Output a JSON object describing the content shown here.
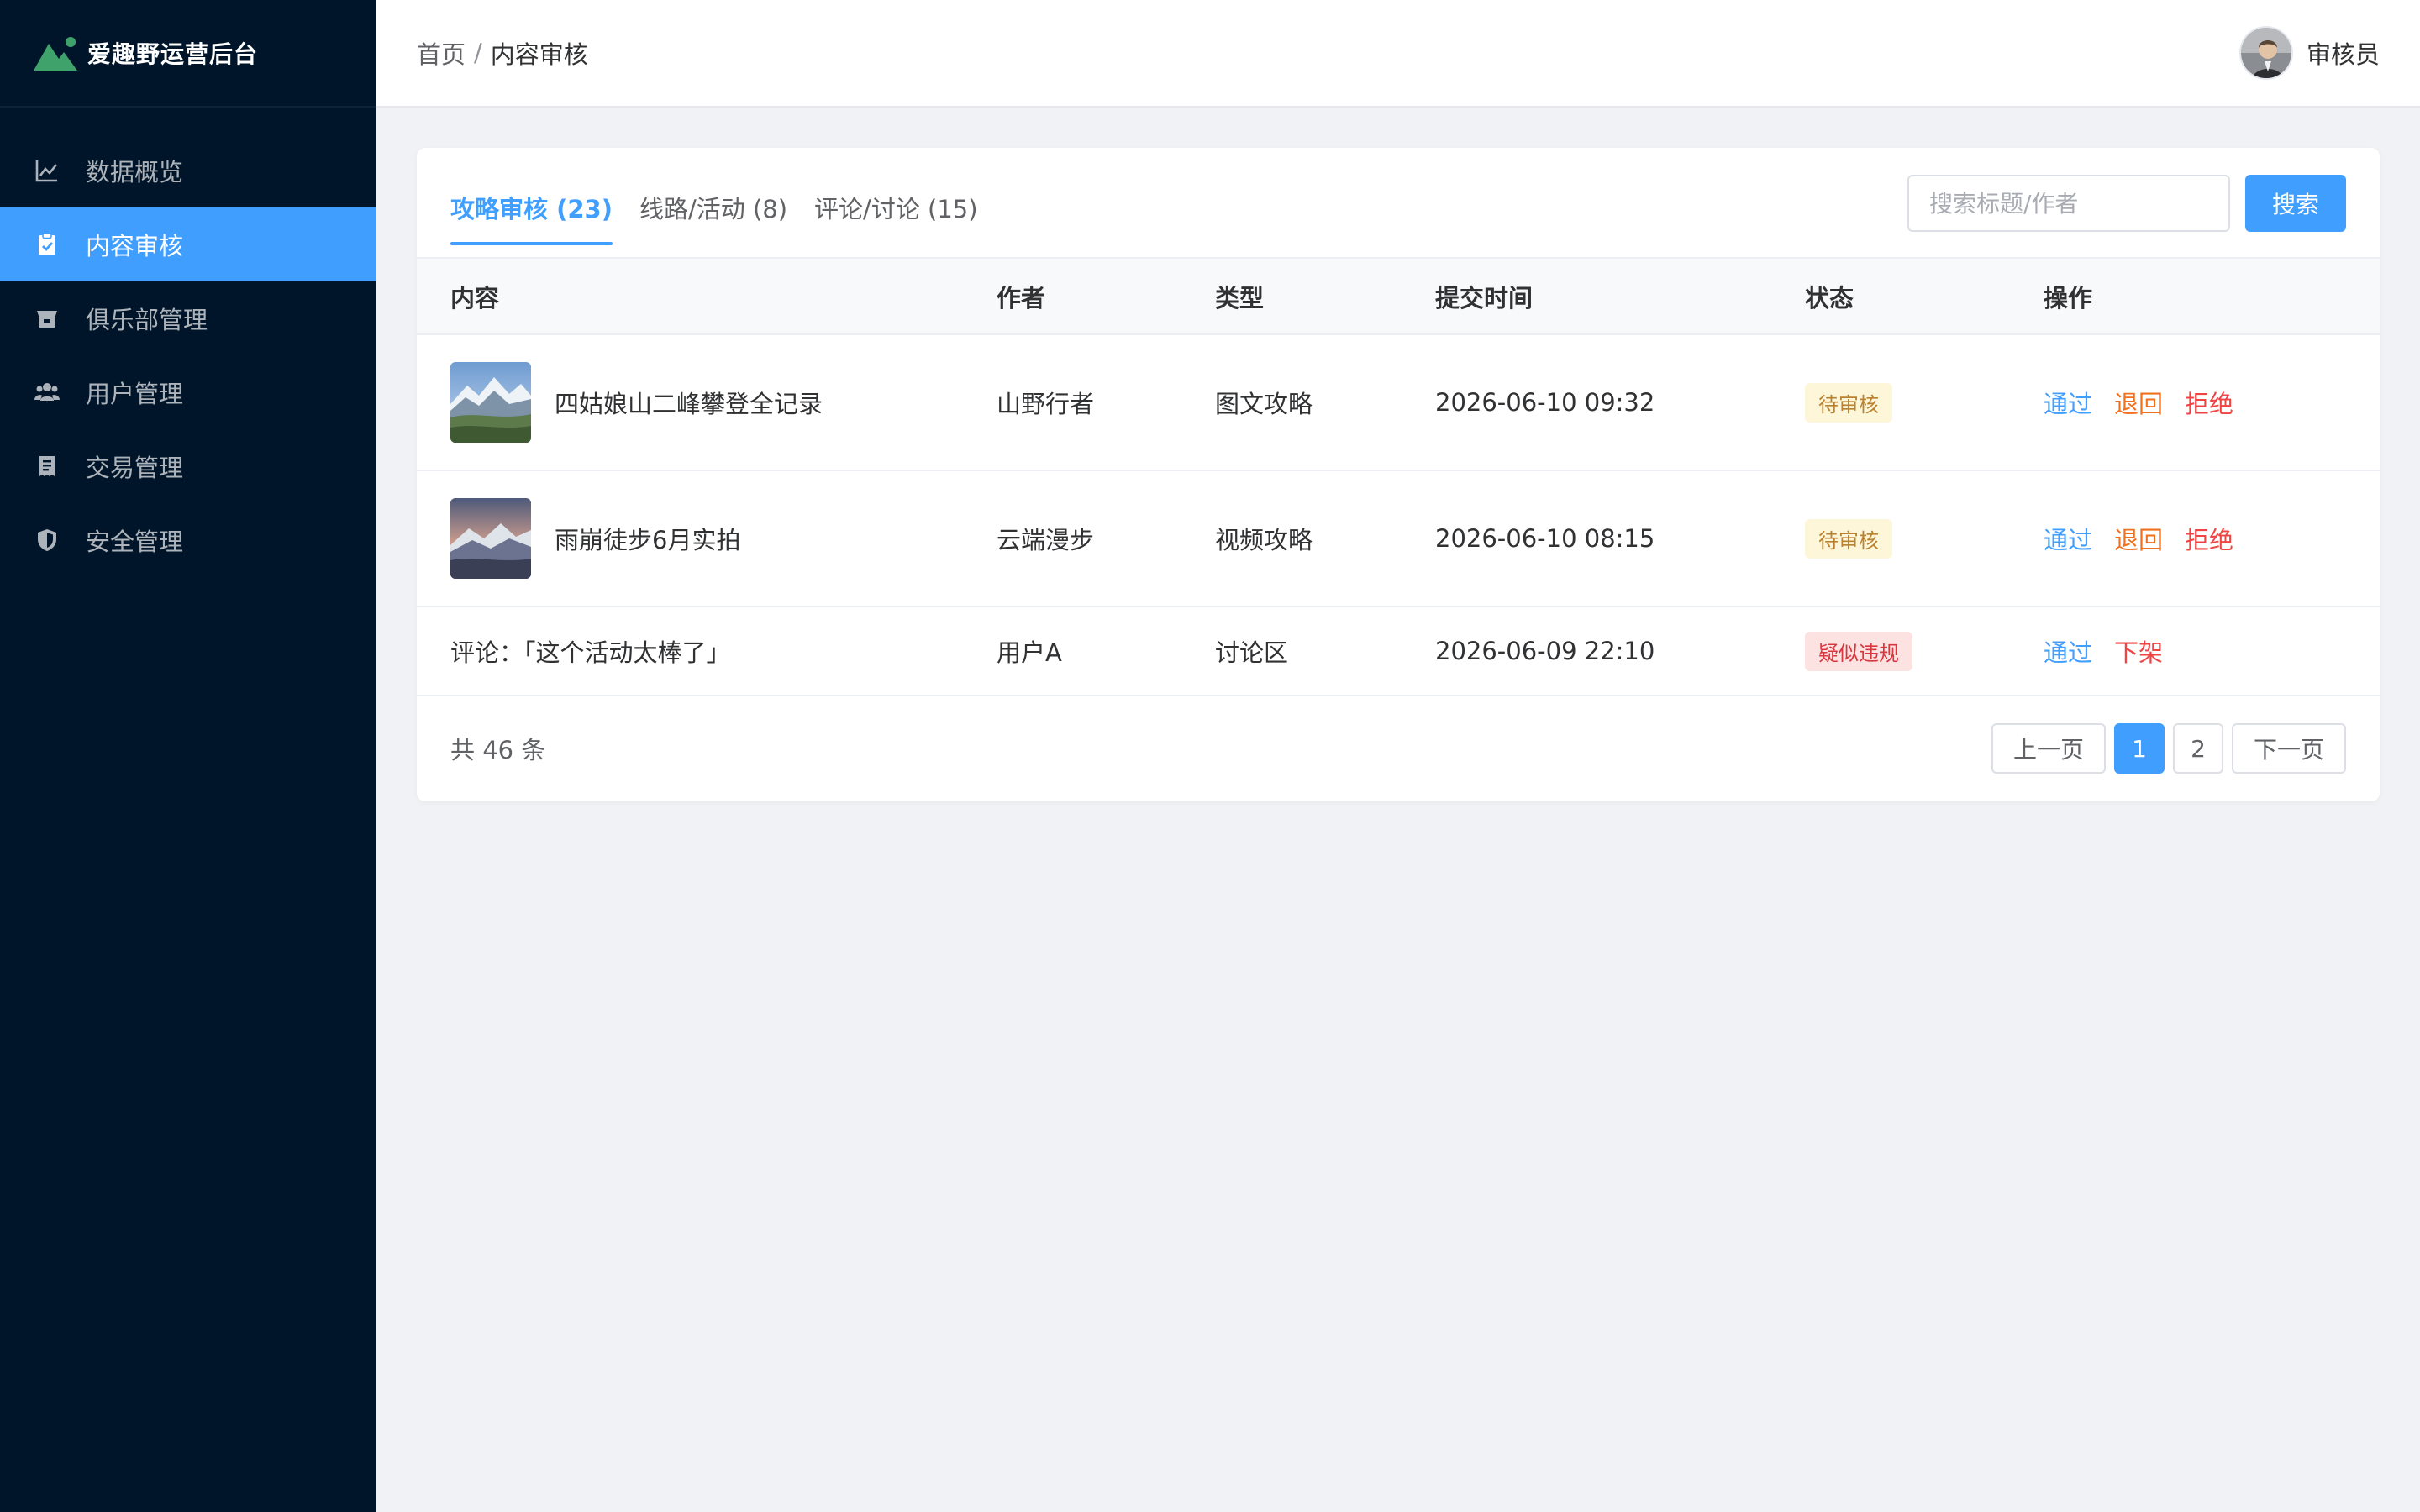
{
  "app": {
    "title": "爱趣野运营后台"
  },
  "sidebar": {
    "items": [
      {
        "label": "数据概览",
        "icon": "chart-line-icon",
        "active": false
      },
      {
        "label": "内容审核",
        "icon": "clipboard-check-icon",
        "active": true
      },
      {
        "label": "俱乐部管理",
        "icon": "store-icon",
        "active": false
      },
      {
        "label": "用户管理",
        "icon": "users-icon",
        "active": false
      },
      {
        "label": "交易管理",
        "icon": "receipt-icon",
        "active": false
      },
      {
        "label": "安全管理",
        "icon": "shield-icon",
        "active": false
      }
    ]
  },
  "header": {
    "breadcrumb": {
      "home": "首页",
      "separator": "/",
      "current": "内容审核"
    },
    "user": {
      "name": "审核员"
    }
  },
  "tabs": [
    {
      "label": "攻略审核 (23)",
      "active": true
    },
    {
      "label": "线路/活动 (8)",
      "active": false
    },
    {
      "label": "评论/讨论 (15)",
      "active": false
    }
  ],
  "search": {
    "placeholder": "搜索标题/作者",
    "button_label": "搜索",
    "value": ""
  },
  "table": {
    "columns": [
      "内容",
      "作者",
      "类型",
      "提交时间",
      "状态",
      "操作"
    ],
    "rows": [
      {
        "content": "四姑娘山二峰攀登全记录",
        "author": "山野行者",
        "type": "图文攻略",
        "time": "2026-06-10 09:32",
        "status": "待审核",
        "actions": [
          "通过",
          "退回",
          "拒绝"
        ]
      },
      {
        "content": "雨崩徒步6月实拍",
        "author": "云端漫步",
        "type": "视频攻略",
        "time": "2026-06-10 08:15",
        "status": "待审核",
        "actions": [
          "通过",
          "退回",
          "拒绝"
        ]
      },
      {
        "content": "评论：「这个活动太棒了」",
        "author": "用户A",
        "type": "讨论区",
        "time": "2026-06-09 22:10",
        "status": "疑似违规",
        "actions": [
          "通过",
          "下架"
        ]
      }
    ]
  },
  "footer": {
    "total": "共 46 条",
    "pagination": {
      "prev": "上一页",
      "pages": [
        "1",
        "2"
      ],
      "current": "1",
      "next": "下一页"
    }
  },
  "colors": {
    "sidebar_bg": "#001529",
    "accent": "#409eff",
    "warning": "#f0701e",
    "danger": "#f04343"
  }
}
